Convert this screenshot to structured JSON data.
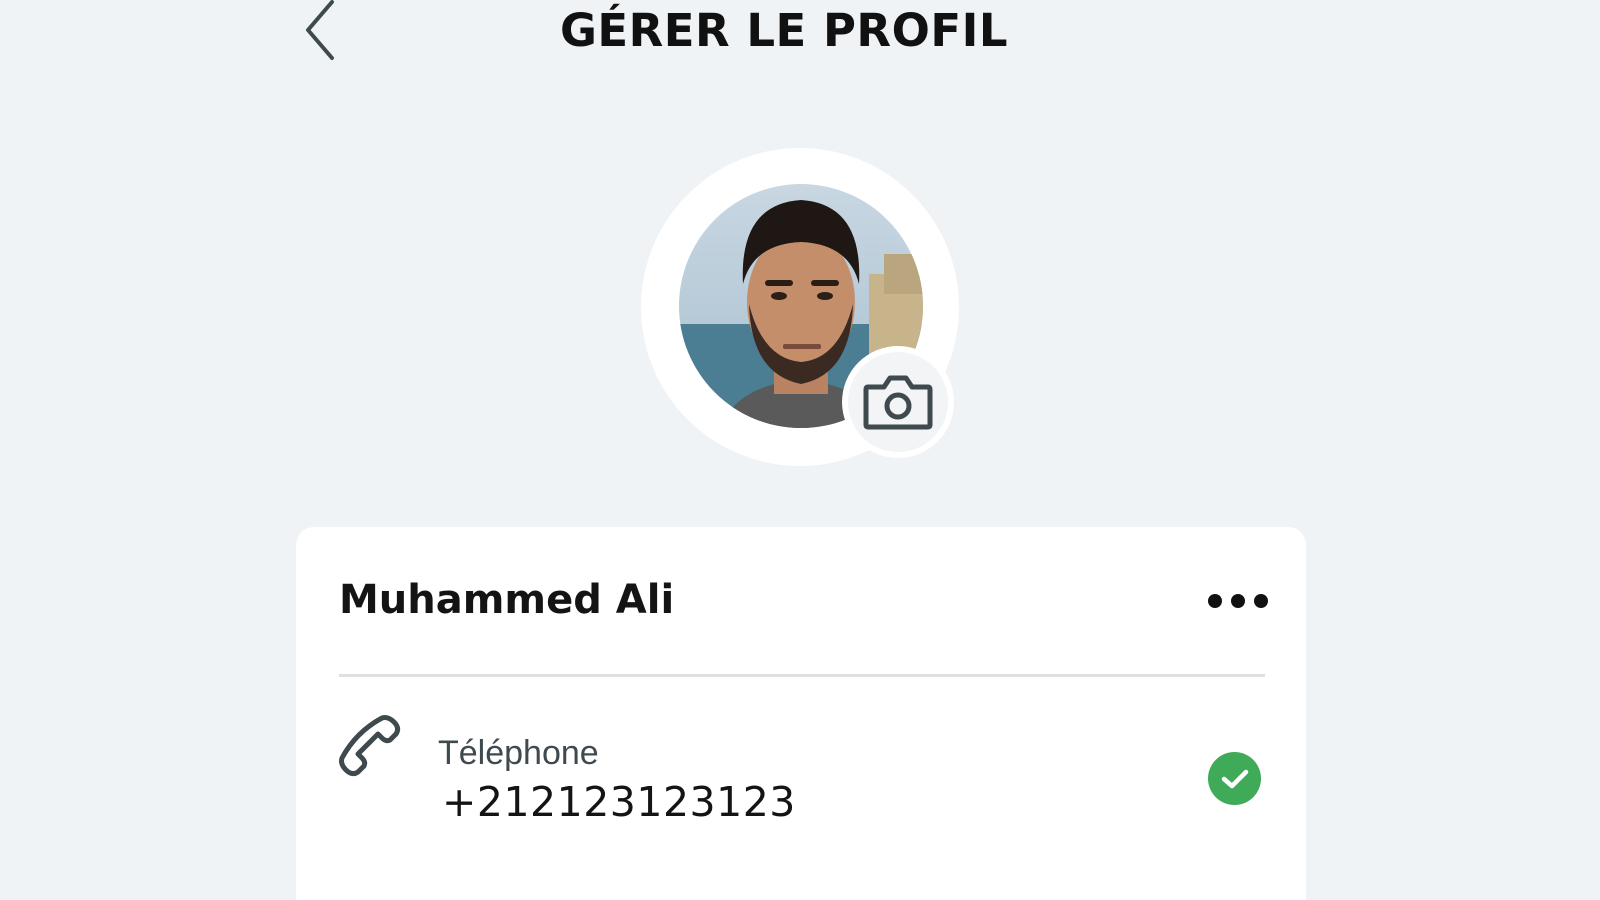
{
  "header": {
    "title": "GÉRER LE PROFIL",
    "back_icon": "chevron-left-icon"
  },
  "avatar": {
    "photo": "profile-photo",
    "camera_icon": "camera-icon"
  },
  "profile": {
    "name": "Muhammed Ali",
    "more_icon": "more-horizontal-icon"
  },
  "phone": {
    "icon": "phone-icon",
    "label": "Téléphone",
    "value": "+212123123123",
    "status_icon": "check-icon",
    "status_color": "#3faa58"
  },
  "colors": {
    "background": "#eff3f6",
    "card": "#ffffff",
    "text": "#141414",
    "icon": "#3f4a4f"
  }
}
